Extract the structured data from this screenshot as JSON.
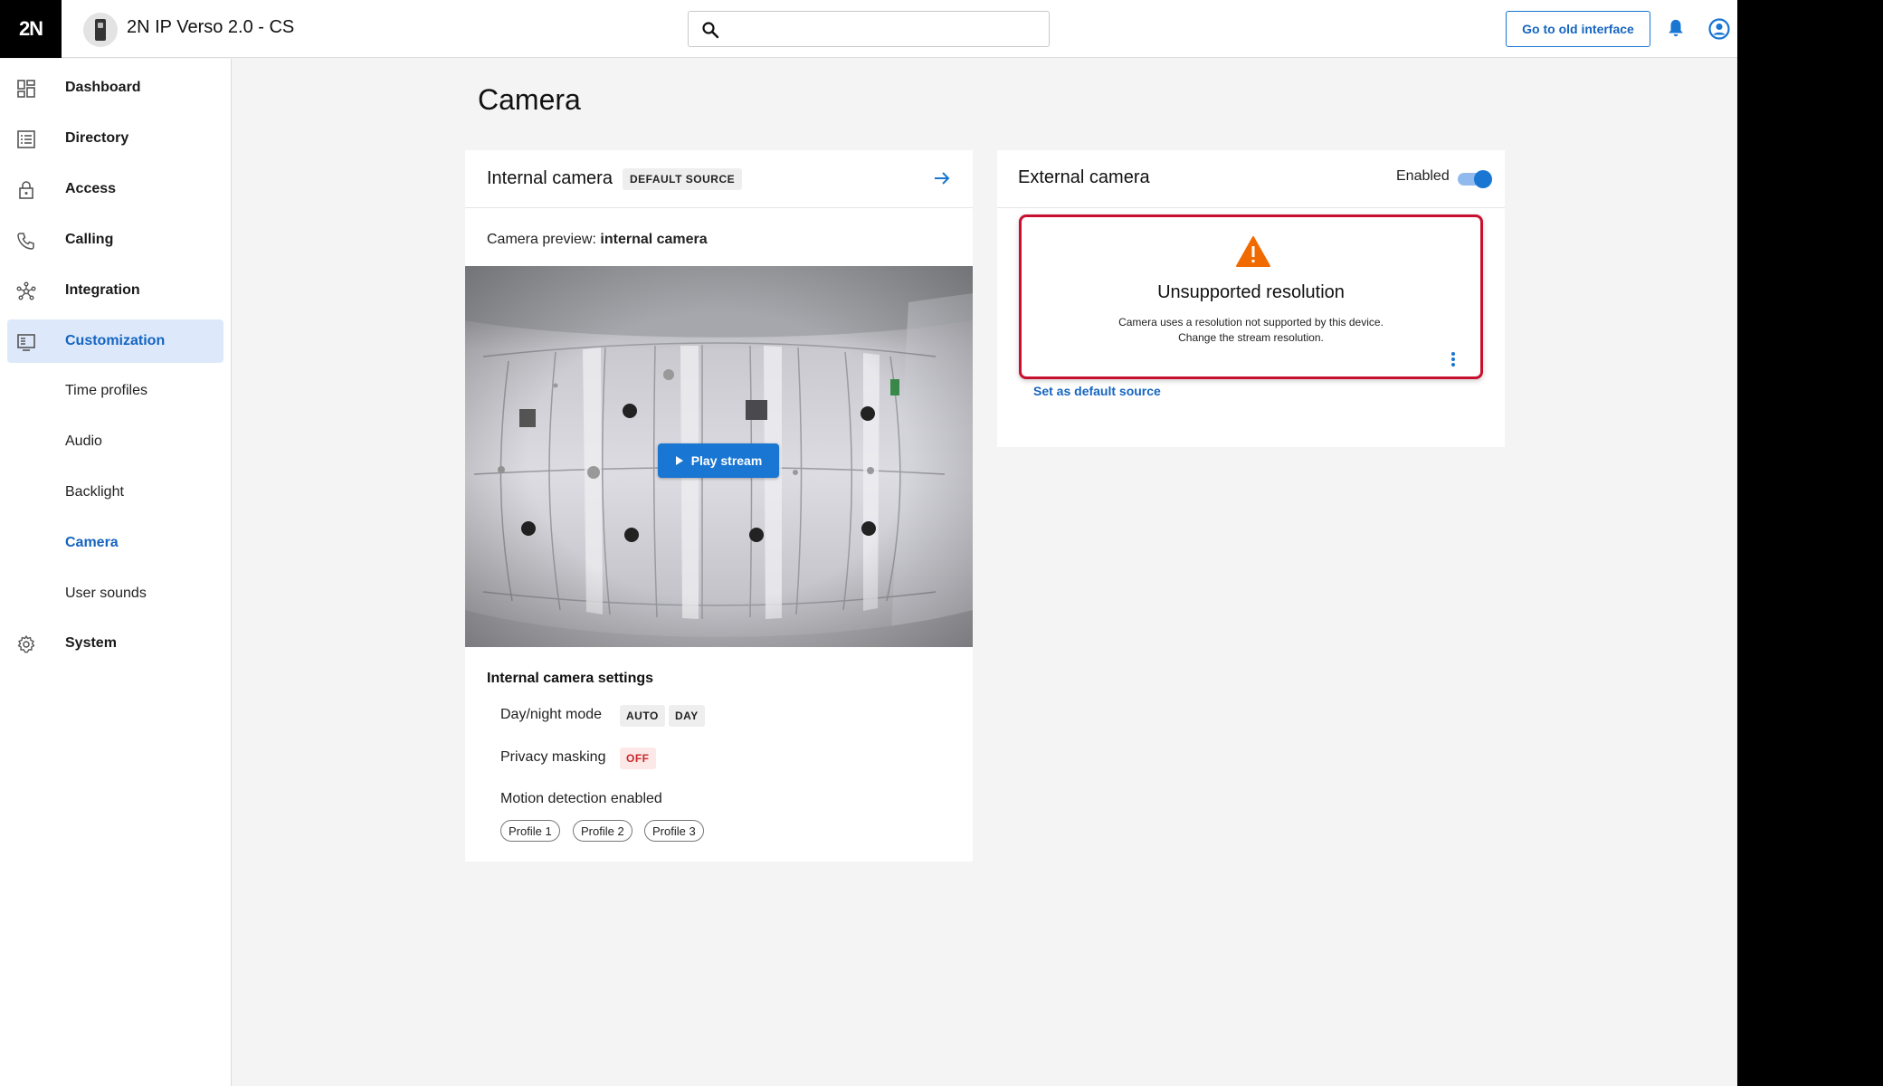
{
  "header": {
    "logo": "2N",
    "title": "2N IP Verso 2.0 - CS",
    "search_placeholder": "",
    "old_interface_button": "Go to old interface"
  },
  "sidebar": {
    "items": [
      {
        "label": "Dashboard",
        "icon": "dashboard-icon"
      },
      {
        "label": "Directory",
        "icon": "directory-icon"
      },
      {
        "label": "Access",
        "icon": "lock-icon"
      },
      {
        "label": "Calling",
        "icon": "phone-icon"
      },
      {
        "label": "Integration",
        "icon": "integration-icon"
      },
      {
        "label": "Customization",
        "icon": "customization-icon",
        "active": true
      },
      {
        "label": "System",
        "icon": "gear-icon"
      }
    ],
    "subitems": [
      "Time profiles",
      "Audio",
      "Backlight",
      "Camera",
      "User sounds"
    ],
    "active_subitem": "Camera"
  },
  "page": {
    "title": "Camera"
  },
  "internal_camera": {
    "title": "Internal camera",
    "default_chip": "DEFAULT SOURCE",
    "preview_prefix": "Camera preview:",
    "preview_source": "internal camera",
    "play_button": "Play stream",
    "settings_title": "Internal camera settings",
    "day_night_label": "Day/night mode",
    "day_night_tags": [
      "AUTO",
      "DAY"
    ],
    "privacy_label": "Privacy masking",
    "privacy_tag": "OFF",
    "motion_label": "Motion detection enabled",
    "profiles": [
      "Profile 1",
      "Profile 2",
      "Profile 3"
    ]
  },
  "external_camera": {
    "title": "External camera",
    "enabled_label": "Enabled",
    "enabled": true,
    "error_title": "Unsupported resolution",
    "error_line1": "Camera uses a resolution not supported by this device.",
    "error_line2": "Change the stream resolution.",
    "set_default_link": "Set as default source"
  },
  "colors": {
    "accent": "#1976d2",
    "error": "#c8102e",
    "warning": "#f06a00"
  }
}
